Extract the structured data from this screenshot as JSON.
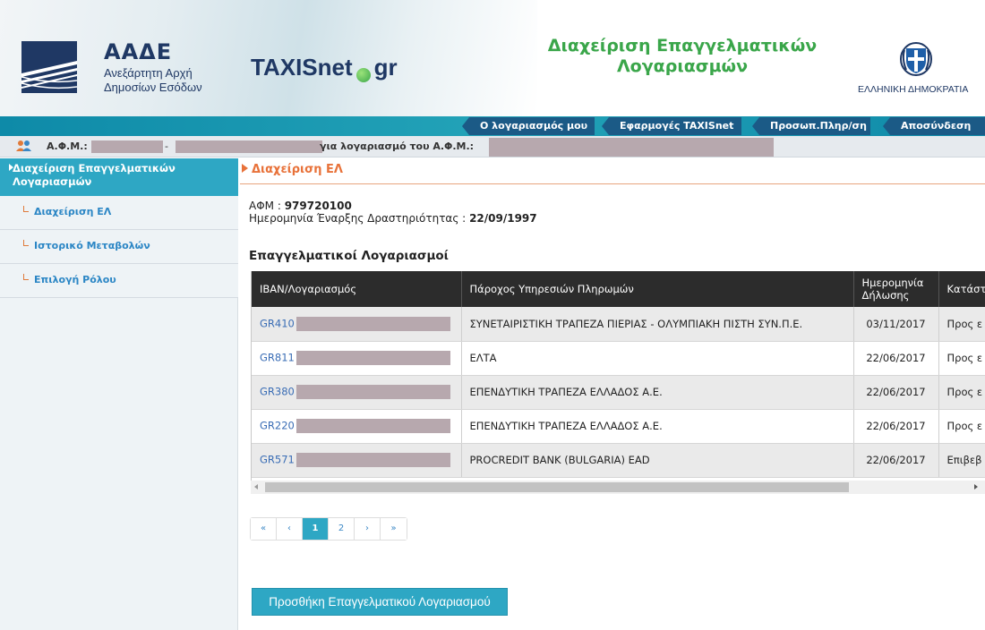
{
  "header": {
    "aade_name": "ΑΑΔΕ",
    "aade_sub1": "Ανεξάρτητη Αρχή",
    "aade_sub2": "Δημοσίων Εσόδων",
    "taxisnet_part1": "TAXISnet",
    "taxisnet_part2": "gr",
    "title_line1": "Διαχείριση Επαγγελματικών",
    "title_line2": "Λογαριασμών",
    "gov_label": "ΕΛΛΗΝΙΚΗ ΔΗΜΟΚΡΑΤΙΑ"
  },
  "topnav": {
    "my_account": "Ο λογαριασμός μου",
    "apps": "Εφαρμογές TAXISnet",
    "personal": "Προσωπ.Πληρ/ση",
    "logout": "Αποσύνδεση"
  },
  "userbar": {
    "afm_label": "Α.Φ.Μ.:",
    "dash": "-",
    "for_account": "για λογαριασμό του Α.Φ.Μ.:"
  },
  "sidebar": {
    "header": "Διαχείριση Επαγγελματικών Λογαριασμών",
    "items": [
      {
        "label": "Διαχείριση ΕΛ"
      },
      {
        "label": "Ιστορικό Μεταβολών"
      },
      {
        "label": "Επιλογή Ρόλου"
      }
    ]
  },
  "main": {
    "breadcrumb": "Διαχείριση ΕΛ",
    "afm_label": "ΑΦΜ :",
    "afm_value": "979720100",
    "date_label": "Ημερομηνία Έναρξης Δραστηριότητας :",
    "date_value": "22/09/1997",
    "section_title": "Επαγγελματικοί Λογαριασμοί"
  },
  "table": {
    "headers": {
      "iban": "IBAN/Λογαριασμός",
      "provider": "Πάροχος Υπηρεσιών Πληρωμών",
      "date_line1": "Ημερομηνία",
      "date_line2": "Δήλωσης",
      "status": "Κατάστ"
    },
    "rows": [
      {
        "iban": "GR410",
        "provider": "ΣΥΝΕΤΑΙΡΙΣΤΙΚΗ ΤΡΑΠΕΖΑ ΠΙΕΡΙΑΣ - ΟΛΥΜΠΙΑΚΗ ΠΙΣΤΗ ΣΥΝ.Π.Ε.",
        "date": "03/11/2017",
        "status": "Προς ε"
      },
      {
        "iban": "GR811",
        "provider": "ΕΛΤΑ",
        "date": "22/06/2017",
        "status": "Προς ε"
      },
      {
        "iban": "GR380",
        "provider": "ΕΠΕΝΔΥΤΙΚΗ ΤΡΑΠΕΖΑ ΕΛΛΑΔΟΣ Α.Ε.",
        "date": "22/06/2017",
        "status": "Προς ε"
      },
      {
        "iban": "GR220",
        "provider": "ΕΠΕΝΔΥΤΙΚΗ ΤΡΑΠΕΖΑ ΕΛΛΑΔΟΣ Α.Ε.",
        "date": "22/06/2017",
        "status": "Προς ε"
      },
      {
        "iban": "GR571",
        "provider": "PROCREDIT BANK (BULGARIA) EAD",
        "date": "22/06/2017",
        "status": "Επιβεβ"
      }
    ]
  },
  "pagination": {
    "first": "«",
    "prev": "‹",
    "pages": [
      "1",
      "2"
    ],
    "next": "›",
    "last": "»",
    "current": "1"
  },
  "add_button": "Προσθήκη Επαγγελματικού Λογαριασμού",
  "colors": {
    "accent": "#2ea7c4",
    "nav_tab": "#1b5a86",
    "breadcrumb": "#e8723a",
    "title_green": "#3aa64a",
    "brand_blue": "#1f3864"
  },
  "icons": {
    "users": "users-icon",
    "emblem": "greek-emblem-icon",
    "aade_logo": "aade-logo-icon"
  }
}
